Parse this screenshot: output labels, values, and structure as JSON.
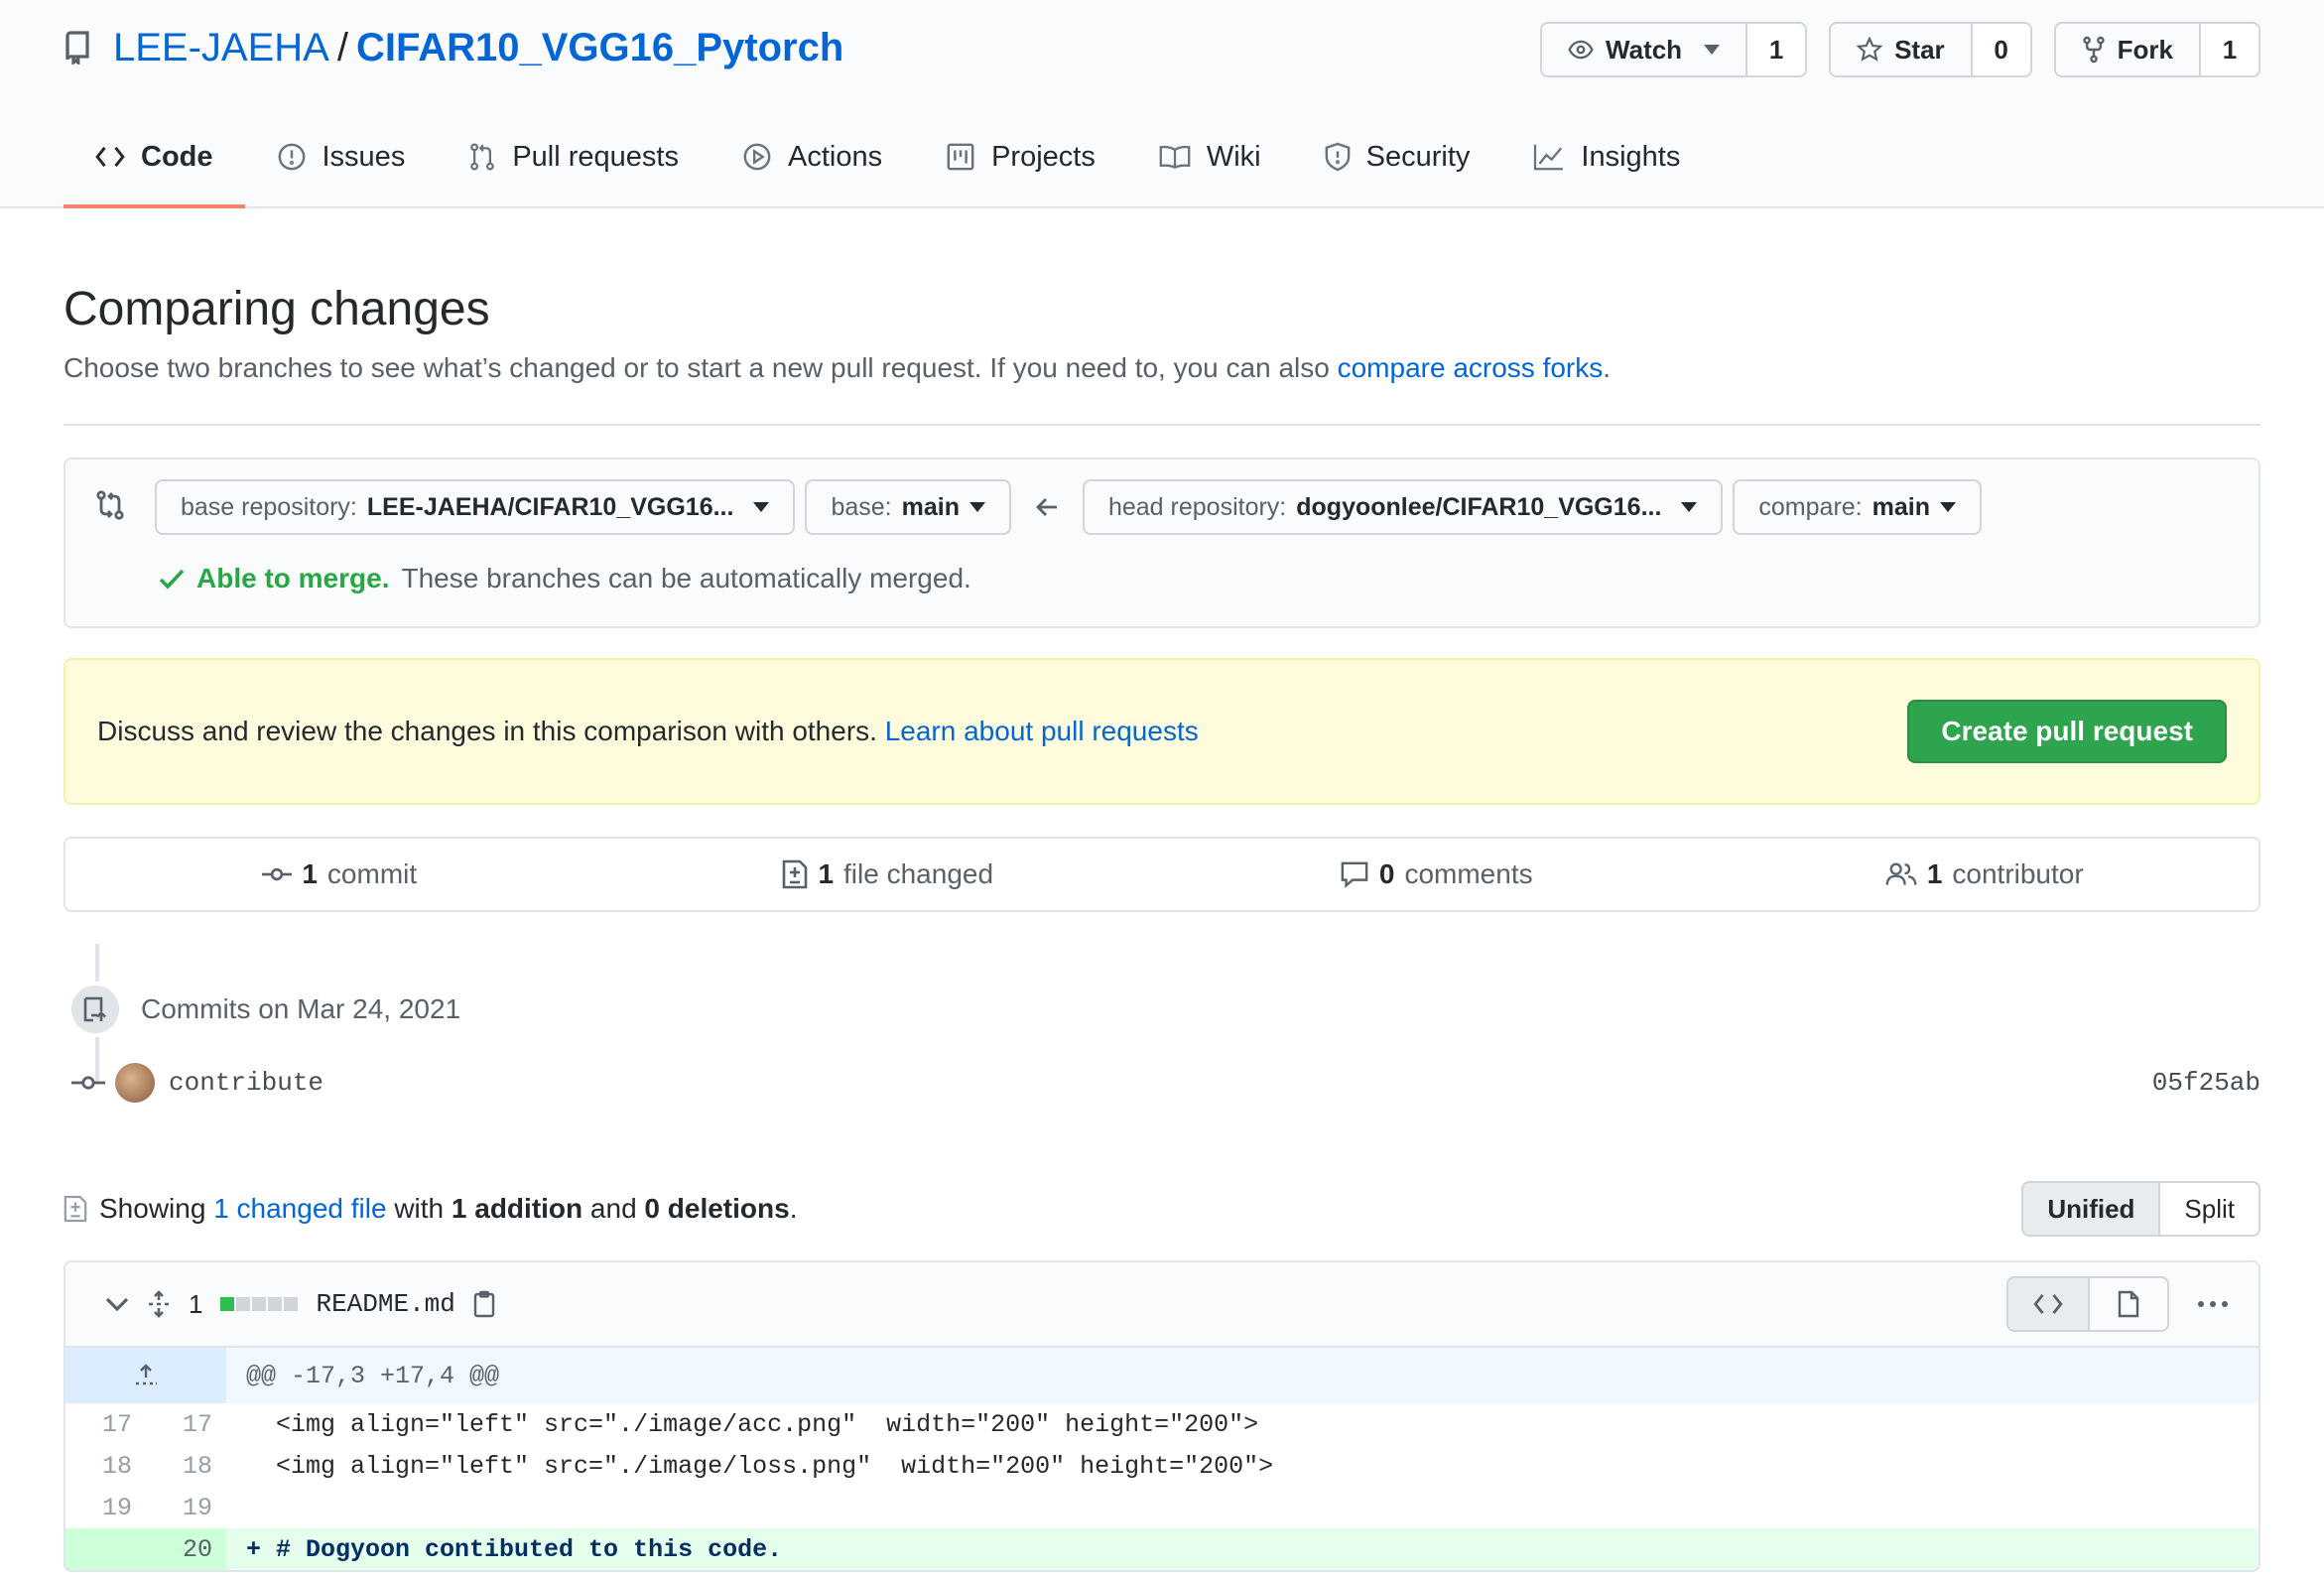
{
  "repo": {
    "owner": "LEE-JAEHA",
    "separator": "/",
    "name": "CIFAR10_VGG16_Pytorch"
  },
  "actions": {
    "watch": {
      "label": "Watch",
      "count": "1"
    },
    "star": {
      "label": "Star",
      "count": "0"
    },
    "fork": {
      "label": "Fork",
      "count": "1"
    }
  },
  "tabs": [
    {
      "label": "Code",
      "icon": "code-icon",
      "selected": true
    },
    {
      "label": "Issues",
      "icon": "issue-icon"
    },
    {
      "label": "Pull requests",
      "icon": "pull-request-icon"
    },
    {
      "label": "Actions",
      "icon": "play-icon"
    },
    {
      "label": "Projects",
      "icon": "project-icon"
    },
    {
      "label": "Wiki",
      "icon": "book-icon"
    },
    {
      "label": "Security",
      "icon": "shield-icon"
    },
    {
      "label": "Insights",
      "icon": "graph-icon"
    }
  ],
  "page": {
    "title": "Comparing changes",
    "description": "Choose two branches to see what’s changed or to start a new pull request. If you need to, you can also ",
    "description_link": "compare across forks",
    "description_end": "."
  },
  "range": {
    "base_repo_label": "base repository:",
    "base_repo_value": "LEE-JAEHA/CIFAR10_VGG16...",
    "base_label": "base:",
    "base_value": "main",
    "head_repo_label": "head repository:",
    "head_repo_value": "dogyoonlee/CIFAR10_VGG16...",
    "compare_label": "compare:",
    "compare_value": "main",
    "merge_ok": "Able to merge.",
    "merge_text": "These branches can be automatically merged."
  },
  "flash": {
    "text": "Discuss and review the changes in this comparison with others.",
    "link": "Learn about pull requests",
    "button": "Create pull request"
  },
  "summary": {
    "commits_count": "1",
    "commits_label": "commit",
    "files_count": "1",
    "files_label": "file changed",
    "comments_count": "0",
    "comments_label": "comments",
    "contributors_count": "1",
    "contributors_label": "contributor"
  },
  "commits": {
    "date_heading": "Commits on Mar 24, 2021",
    "items": [
      {
        "message": "contribute",
        "sha": "05f25ab"
      }
    ]
  },
  "files_summary": {
    "showing": "Showing",
    "changed_link": "1 changed file",
    "with": "with",
    "additions": "1 addition",
    "and": "and",
    "deletions": "0 deletions",
    "end": "."
  },
  "view_toggle": {
    "unified": "Unified",
    "split": "Split"
  },
  "file": {
    "changes": "1",
    "diffstat_additions": 1,
    "diffstat_total_blocks": 5,
    "name": "README.md",
    "hunk": "@@ -17,3 +17,4 @@",
    "lines": [
      {
        "old": "17",
        "new": "17",
        "type": "context",
        "code": "  <img align=\"left\" src=\"./image/acc.png\"  width=\"200\" height=\"200\">"
      },
      {
        "old": "18",
        "new": "18",
        "type": "context",
        "code": "  <img align=\"left\" src=\"./image/loss.png\"  width=\"200\" height=\"200\">"
      },
      {
        "old": "19",
        "new": "19",
        "type": "context",
        "code": ""
      },
      {
        "old": "",
        "new": "20",
        "type": "add",
        "code": "+ # Dogyoon contibuted to this code."
      }
    ]
  },
  "colors": {
    "accent": "#0366d6",
    "success": "#2ea44f",
    "tab_underline": "#f9826c",
    "flash_bg": "#fffbdd"
  }
}
